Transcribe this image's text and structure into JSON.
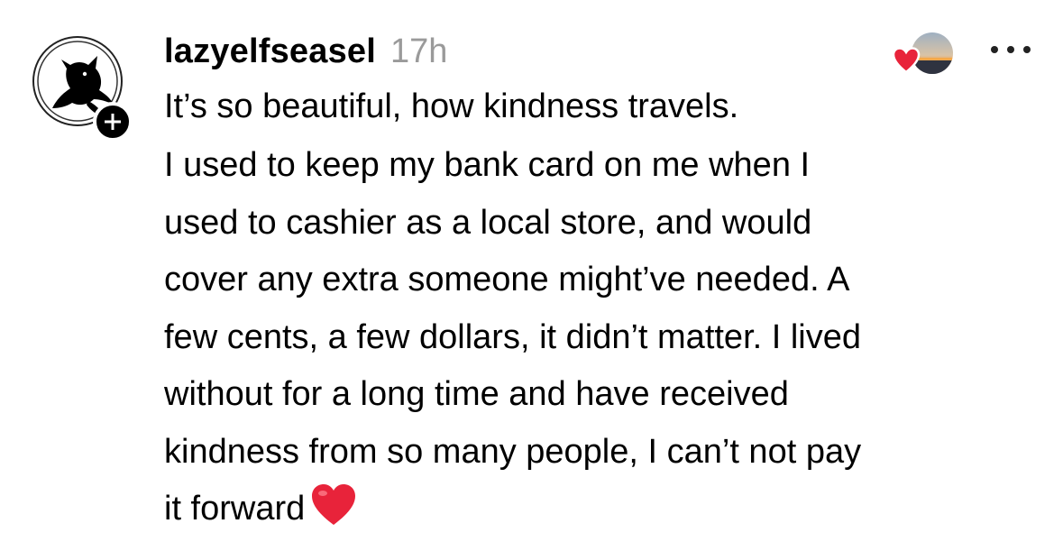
{
  "post": {
    "username": "lazyelfseasel",
    "timestamp": "17h",
    "title": "It’s so beautiful, how kindness travels.",
    "body_lines": [
      "I used to keep my bank card on me when I",
      "used to cashier as a local store, and would",
      "cover any extra someone might’ve needed. A",
      "few cents, a few dollars, it didn’t matter. I lived",
      "without for a long time and have received",
      "kindness from so many people, I can’t not pay",
      "it forward"
    ],
    "trailing_emoji": "red-heart-emoji"
  },
  "icons": {
    "avatar": "black-fox-icon",
    "follow": "plus-icon",
    "liked_by": "heart-icon",
    "more": "more-options-icon"
  },
  "colors": {
    "timestamp": "#9a9a9a",
    "heart": "#e8233a",
    "text": "#000000"
  }
}
